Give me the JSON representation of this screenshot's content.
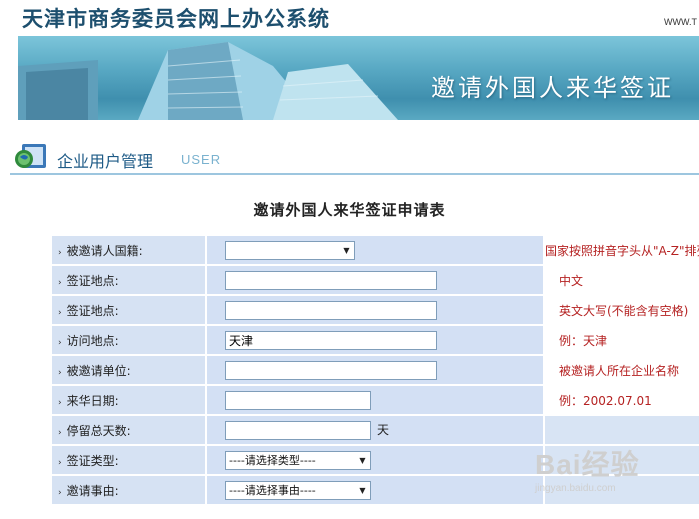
{
  "header": {
    "site_title": "天津市商务委员会网上办公系统",
    "site_url": "WWW.T",
    "banner_title": "邀请外国人来华签证"
  },
  "section": {
    "title": "企业用户管理",
    "subtitle": "USER"
  },
  "form": {
    "title": "邀请外国人来华签证申请表",
    "rows": [
      {
        "label": "被邀请人国籍:",
        "control": "select",
        "value": "",
        "hint": "国家按照拼音字头从\"A-Z\"排列"
      },
      {
        "label": "签证地点:",
        "control": "text",
        "value": "",
        "hint": "中文"
      },
      {
        "label": "签证地点:",
        "control": "text",
        "value": "",
        "hint": "英文大写(不能含有空格)"
      },
      {
        "label": "访问地点:",
        "control": "text",
        "value": "天津",
        "hint": "例：天津"
      },
      {
        "label": "被邀请单位:",
        "control": "text",
        "value": "",
        "hint": "被邀请人所在企业名称"
      },
      {
        "label": "来华日期:",
        "control": "text",
        "value": "",
        "hint": "例：2002.07.01"
      },
      {
        "label": "停留总天数:",
        "control": "text",
        "value": "",
        "unit": "天",
        "hint": ""
      },
      {
        "label": "签证类型:",
        "control": "select",
        "value": "----请选择类型----",
        "hint": ""
      },
      {
        "label": "邀请事由:",
        "control": "select",
        "value": "----请选择事由----",
        "hint": ""
      }
    ]
  },
  "watermark": {
    "brand": "Bai经验",
    "url": "jingyan.baidu.com"
  },
  "colors": {
    "title_blue": "#1d4f6e",
    "label_bg": "#d6e2f3",
    "hint_red": "#b52222"
  }
}
